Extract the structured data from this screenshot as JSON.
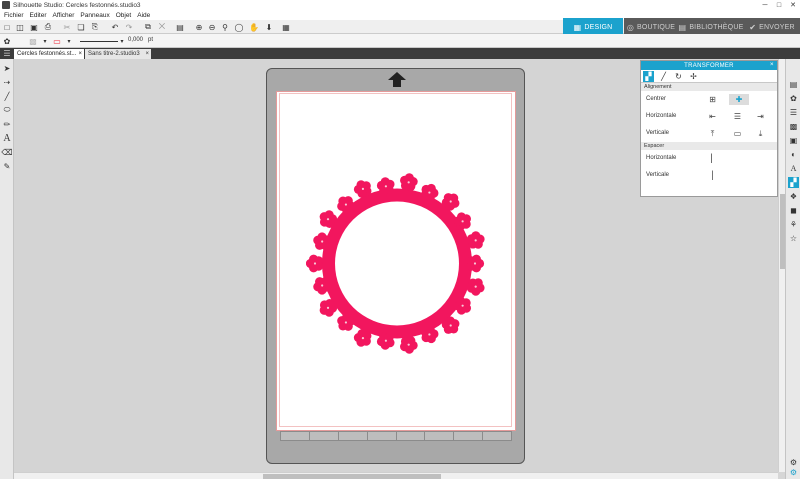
{
  "window": {
    "title": "Silhouette Studio: Cercles festonnés.studio3",
    "minimize": "─",
    "maximize": "□",
    "close": "✕"
  },
  "menu": [
    "Fichier",
    "Editer",
    "Afficher",
    "Panneaux",
    "Objet",
    "Aide"
  ],
  "nav": {
    "design": "DESIGN",
    "boutique": "BOUTIQUE",
    "bibliotheque": "BIBLIOTHÈQUE",
    "envoyer": "ENVOYER"
  },
  "properties": {
    "line_width_value": "0,000",
    "line_width_unit": "pt"
  },
  "tabs": [
    {
      "label": "Cercles festonnés.st...",
      "active": true
    },
    {
      "label": "Sans titre-2.studio3",
      "active": false
    }
  ],
  "panel": {
    "title": "TRANSFORMER",
    "close": "×",
    "alignment_section": "Alignement",
    "center_label": "Centrer",
    "horizontal_label": "Horizontale",
    "vertical_label": "Verticale",
    "spacing_section": "Espacer",
    "spacing_horizontal_label": "Horizontale",
    "spacing_vertical_label": "Verticale"
  },
  "colors": {
    "accent": "#1ba2cd",
    "wreath": "#f2165e",
    "mat": "#a8a8a8",
    "cut_border": "#e59a9a"
  },
  "icons": {
    "toolbar": [
      "new-icon",
      "open-icon",
      "save-icon",
      "print-icon",
      "cut-icon",
      "copy-icon",
      "paste-icon",
      "undo-icon",
      "redo-icon",
      "group-icon",
      "ungroup-icon",
      "zoom-in-icon",
      "zoom-out-icon",
      "zoom-fit-icon",
      "pan-icon",
      "move-down-icon",
      "fit-page-icon"
    ],
    "left_tools": [
      "select-icon",
      "point-edit-icon",
      "line-icon",
      "ellipse-icon",
      "pencil-icon",
      "text-icon",
      "eraser-icon",
      "knife-icon"
    ],
    "right_panels": [
      "page-setup-icon",
      "fill-icon",
      "line-style-icon",
      "shadow-icon",
      "offset-icon",
      "text-style-icon",
      "transform-icon",
      "replicate-icon",
      "modify-icon",
      "trace-icon",
      "star-icon"
    ]
  }
}
